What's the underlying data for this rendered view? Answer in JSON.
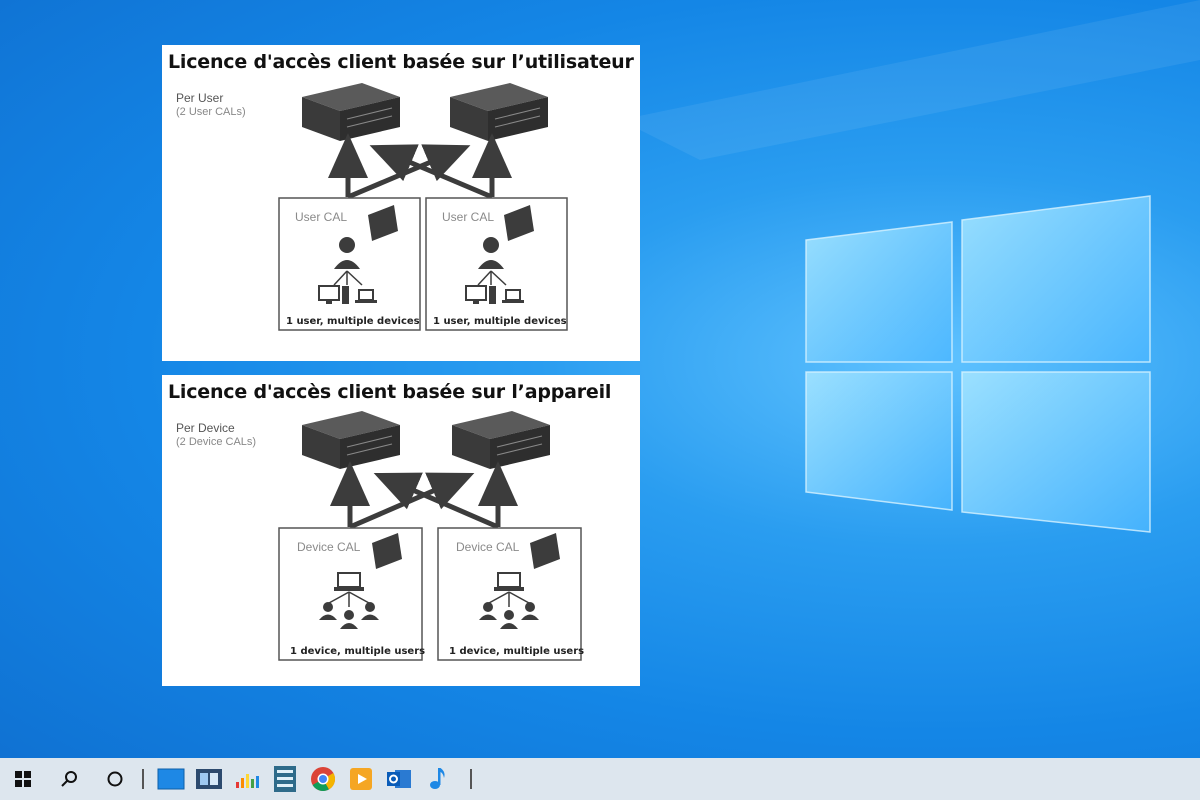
{
  "diagrams": {
    "user": {
      "title": "Licence d'accès client basée sur l’utilisateur",
      "subtitle": "Per User",
      "note": "(2 User CALs)",
      "boxes": [
        {
          "label": "User CAL",
          "caption": "1 user, multiple devices"
        },
        {
          "label": "User CAL",
          "caption": "1 user, multiple devices"
        }
      ]
    },
    "device": {
      "title": "Licence d'accès client basée sur l’appareil",
      "subtitle": "Per Device",
      "note": "(2 Device CALs)",
      "boxes": [
        {
          "label": "Device CAL",
          "caption": "1 device, multiple users"
        },
        {
          "label": "Device CAL",
          "caption": "1 device, multiple users"
        }
      ]
    }
  },
  "taskbar": {
    "start_icon": "windows-start-icon",
    "search_icon": "search-icon",
    "cortana_icon": "cortana-circle-icon",
    "apps": [
      "desktop-icon",
      "task-view-icon",
      "equalizer-app-icon",
      "blue-stack-app-icon",
      "chrome-icon",
      "media-player-icon",
      "outlook-icon",
      "music-note-icon"
    ]
  },
  "colors": {
    "desktop_blue": "#1486e6",
    "diagram_dark": "#3c3c3c",
    "taskbar": "#dde6ee"
  }
}
